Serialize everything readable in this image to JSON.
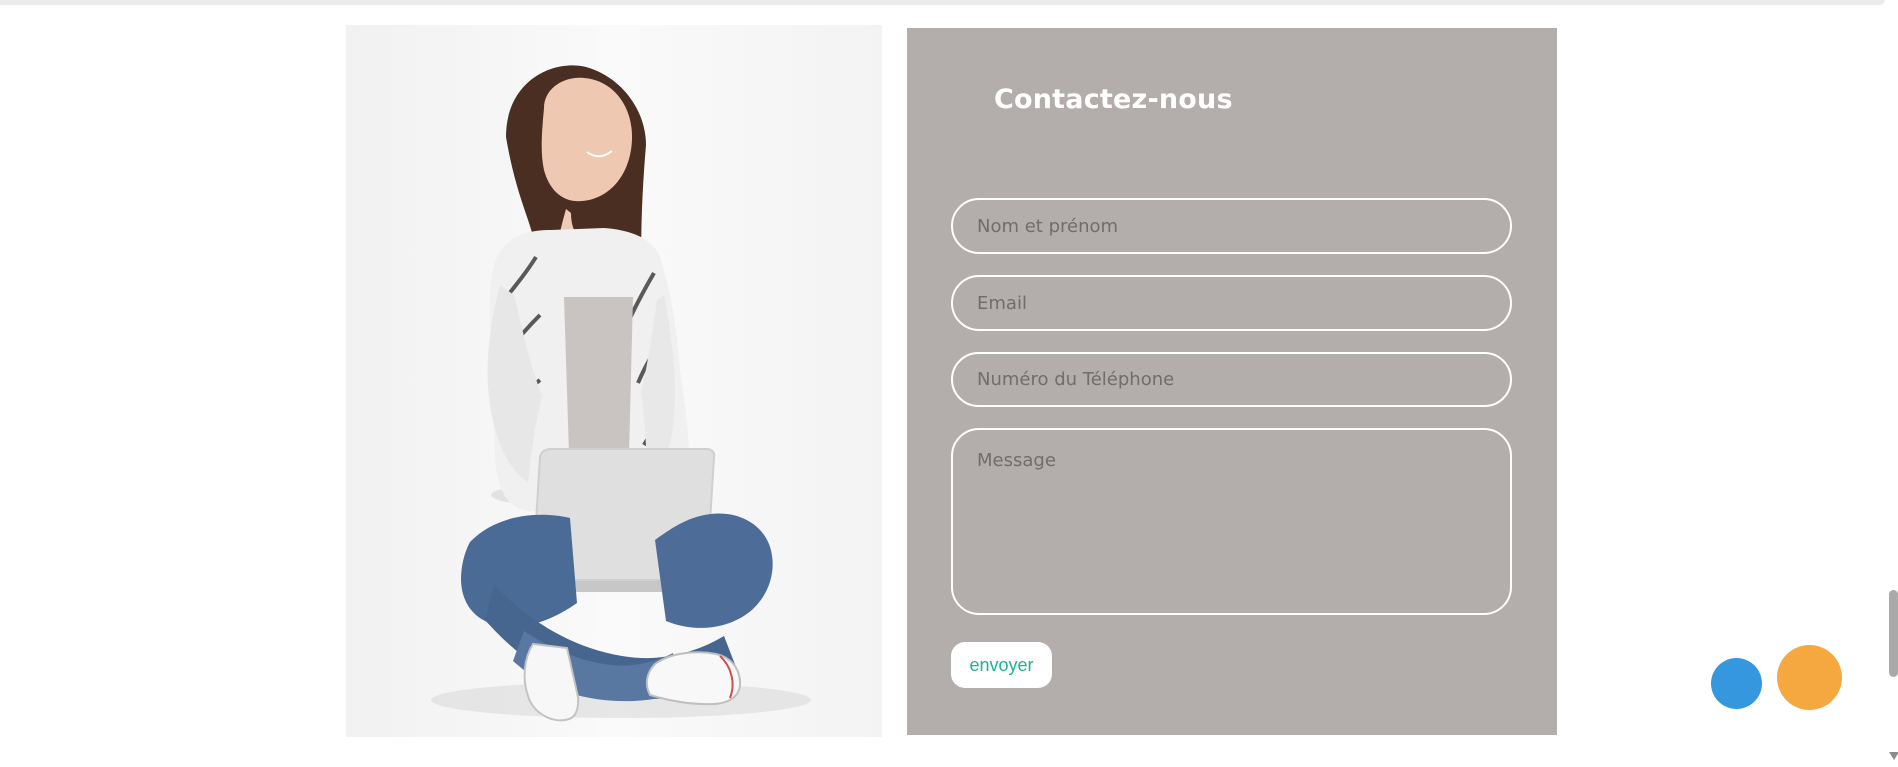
{
  "contact": {
    "title": "Contactez-nous",
    "fields": {
      "name_placeholder": "Nom et prénom",
      "email_placeholder": "Email",
      "phone_placeholder": "Numéro du Téléphone",
      "message_placeholder": "Message"
    },
    "submit_label": "envoyer"
  },
  "colors": {
    "panel_bg": "#b3aeac",
    "accent_text": "#1ab394",
    "floating_blue": "#3597de",
    "floating_orange": "#f5a840"
  }
}
